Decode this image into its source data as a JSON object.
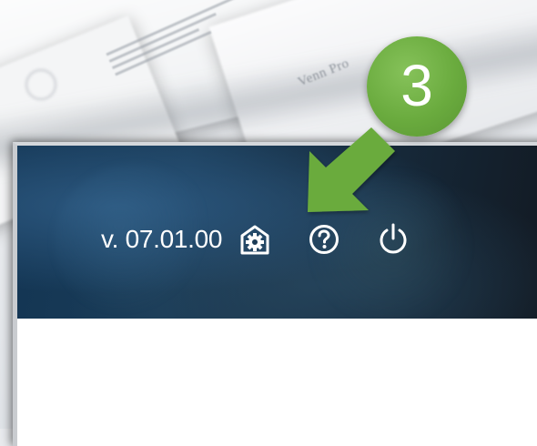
{
  "toolbar": {
    "version_label": "v. 07.01.00",
    "buttons": [
      {
        "name": "settings",
        "icon": "house-gear-icon"
      },
      {
        "name": "help",
        "icon": "question-circle-icon"
      },
      {
        "name": "power",
        "icon": "power-icon"
      }
    ]
  },
  "callout": {
    "step_number": "3",
    "color": "#6aab3e",
    "target": "settings-button"
  },
  "colors": {
    "header_dark": "#133553",
    "header_text": "#ffffff",
    "callout_green": "#6aab3e"
  }
}
